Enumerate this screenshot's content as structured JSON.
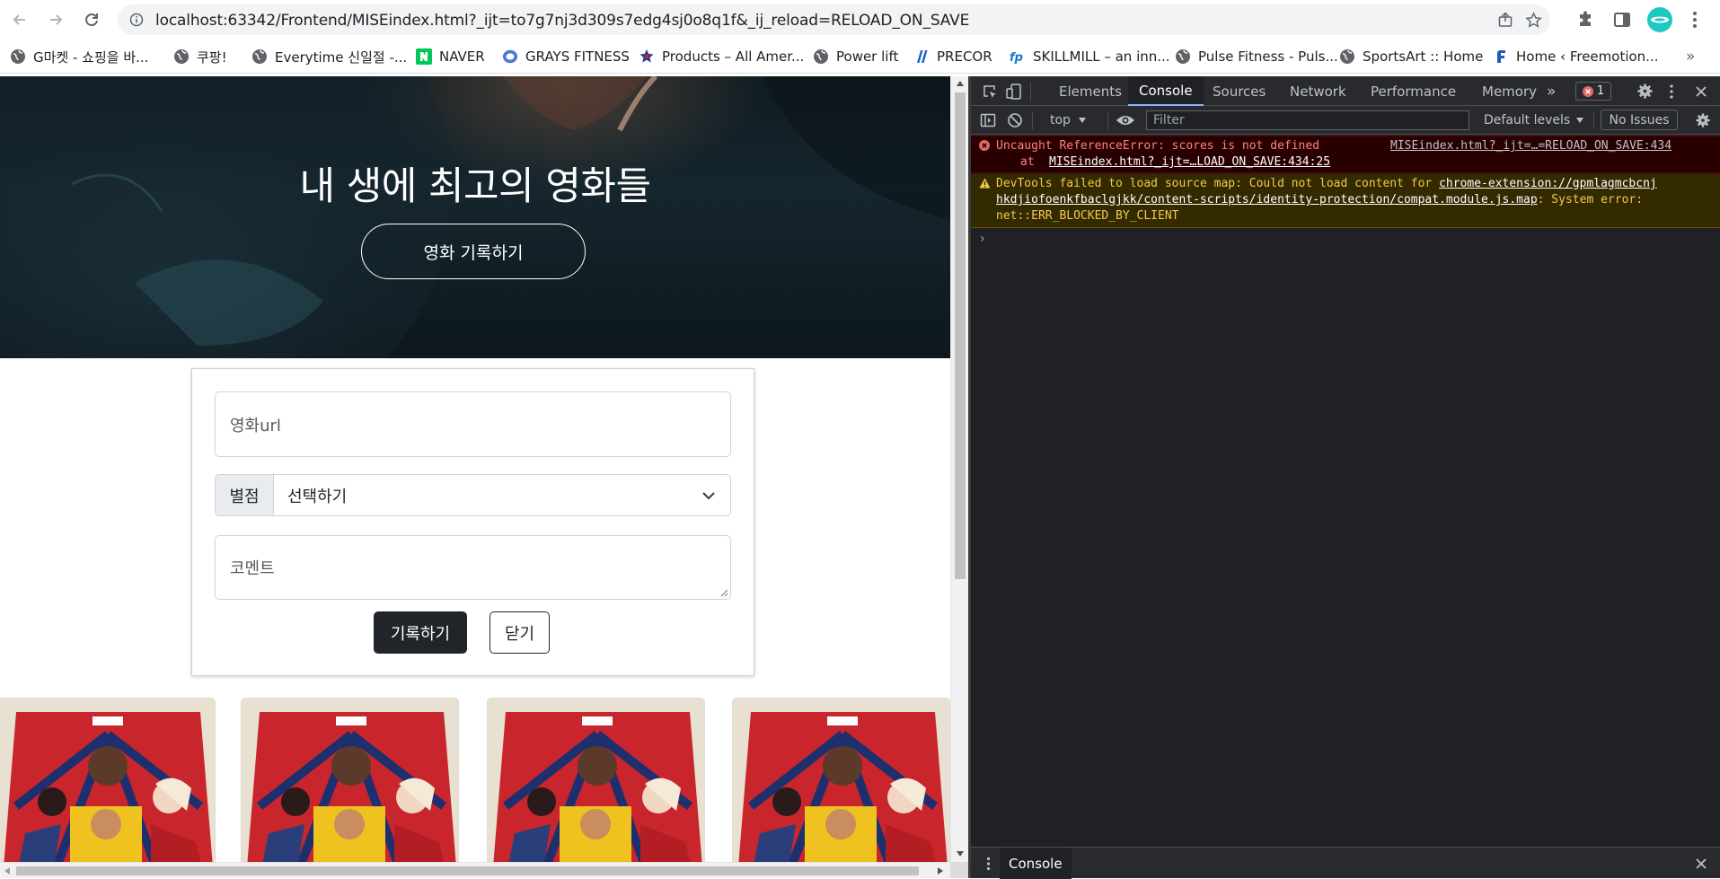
{
  "browser": {
    "url_main": "localhost:63342/Frontend/MISEindex.html?_ijt=to7g7nj3d309s7edg4sj0o8q1f&_ij_reload=RELOAD_ON_SAVE",
    "bookmarks": [
      {
        "label": "G마켓 - 쇼핑을 바...",
        "icon": "globe-icon"
      },
      {
        "label": "쿠팡!",
        "icon": "globe-icon"
      },
      {
        "label": "Everytime 신일절 -...",
        "icon": "globe-icon"
      },
      {
        "label": "NAVER",
        "icon": "naver-icon"
      },
      {
        "label": "GRAYS FITNESS",
        "icon": "grays-icon"
      },
      {
        "label": "Products – All Amer...",
        "icon": "star-logo-icon"
      },
      {
        "label": "Power lift",
        "icon": "globe-icon"
      },
      {
        "label": "PRECOR",
        "icon": "precor-icon"
      },
      {
        "label": "SKILLMILL – an inn...",
        "icon": "fp-icon"
      },
      {
        "label": "Pulse Fitness - Puls...",
        "icon": "globe-icon"
      },
      {
        "label": "SportsArt :: Home",
        "icon": "globe-icon"
      },
      {
        "label": "Home ‹ Freemotion...",
        "icon": "freemotion-icon"
      }
    ],
    "more_bookmarks": "»"
  },
  "page": {
    "hero_title": "내 생에 최고의 영화들",
    "hero_button": "영화 기록하기",
    "form": {
      "url_placeholder": "영화url",
      "rating_label": "별점",
      "rating_selected": "선택하기",
      "comment_placeholder": "코멘트",
      "save_button": "기록하기",
      "close_button": "닫기"
    },
    "cards": [
      {
        "name": "movie-card-1"
      },
      {
        "name": "movie-card-2"
      },
      {
        "name": "movie-card-3"
      },
      {
        "name": "movie-card-4"
      }
    ]
  },
  "devtools": {
    "tabs": [
      "Elements",
      "Console",
      "Sources",
      "Network",
      "Performance",
      "Memory"
    ],
    "active_tab": "Console",
    "more_tabs": "»",
    "error_count": "1",
    "context": "top",
    "filter_placeholder": "Filter",
    "levels": "Default levels",
    "issues": "No Issues",
    "error": {
      "line1": "Uncaught ReferenceError: scores is not defined",
      "source": "MISEindex.html?_ijt=…=RELOAD_ON_SAVE:434",
      "line2_prefix": "at ",
      "line2_link": "MISEindex.html?_ijt=…LOAD_ON_SAVE:434:25"
    },
    "warning": {
      "prefix": "DevTools failed to load source map: Could not load content for ",
      "link1": "chrome-extension://gpmlagmcbcnj",
      "link2": "hkdjiofoenkfbaclgjkk/content-scripts/identity-protection/compat.module.js.map",
      "suffix": ": System error:",
      "line3": "net::ERR_BLOCKED_BY_CLIENT"
    },
    "prompt": "›",
    "drawer_tab": "Console"
  },
  "colors": {
    "accent": "#8ab4f8",
    "error_text": "#ff8080",
    "warning_text": "#f2c94c",
    "dark_button": "#212529"
  }
}
